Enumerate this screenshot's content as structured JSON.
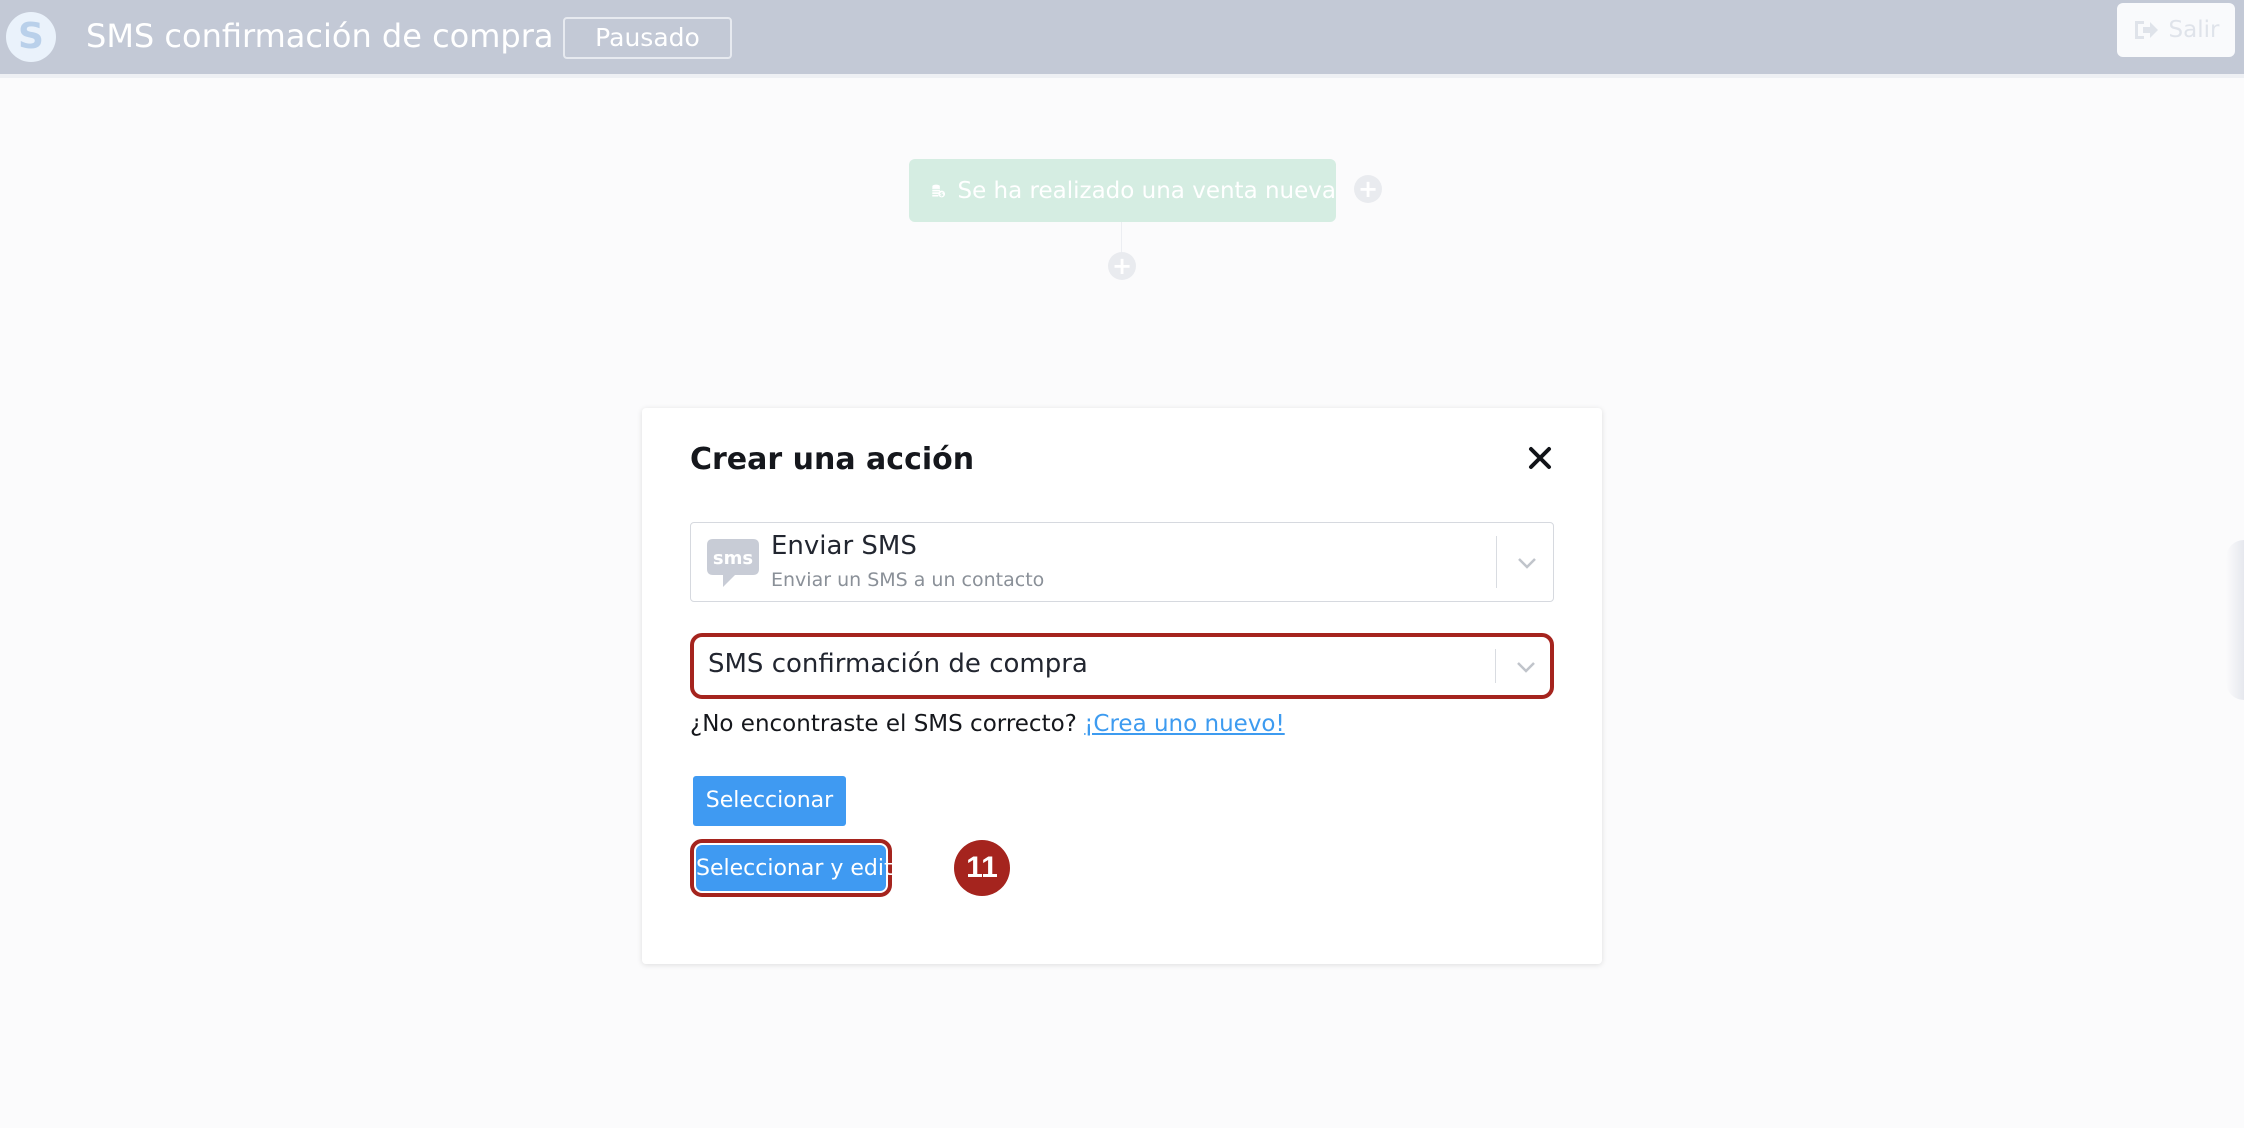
{
  "header": {
    "logo_letter": "S",
    "workflow_title": "SMS confirmación de compra",
    "status": "Pausado",
    "exit_label": "Salir"
  },
  "canvas": {
    "trigger_label": "Se ha realizado una venta nueva",
    "add_symbol": "+"
  },
  "modal": {
    "title": "Crear una acción",
    "action_select": {
      "icon_text": "sms",
      "title": "Enviar SMS",
      "subtitle": "Enviar un SMS a un contacto"
    },
    "sms_select": {
      "value": "SMS confirmación de compra"
    },
    "not_found_text": "¿No encontraste el SMS correcto?",
    "create_link": "¡Crea uno nuevo!",
    "select_button": "Seleccionar",
    "select_edit_button": "Seleccionar y editar",
    "step_badge": "11"
  },
  "colors": {
    "header_bg": "#c3c9d6",
    "primary_button": "#3f9af2",
    "highlight": "#a5241e",
    "link": "#3d9bf0",
    "trigger_node": "#d5ede2"
  },
  "icons": {
    "logo": "brand-logo",
    "exit": "sign-out-icon",
    "trigger": "coins-icon",
    "action": "sms-bubble-icon",
    "close": "close-icon",
    "dropdown": "chevron-down-icon"
  }
}
